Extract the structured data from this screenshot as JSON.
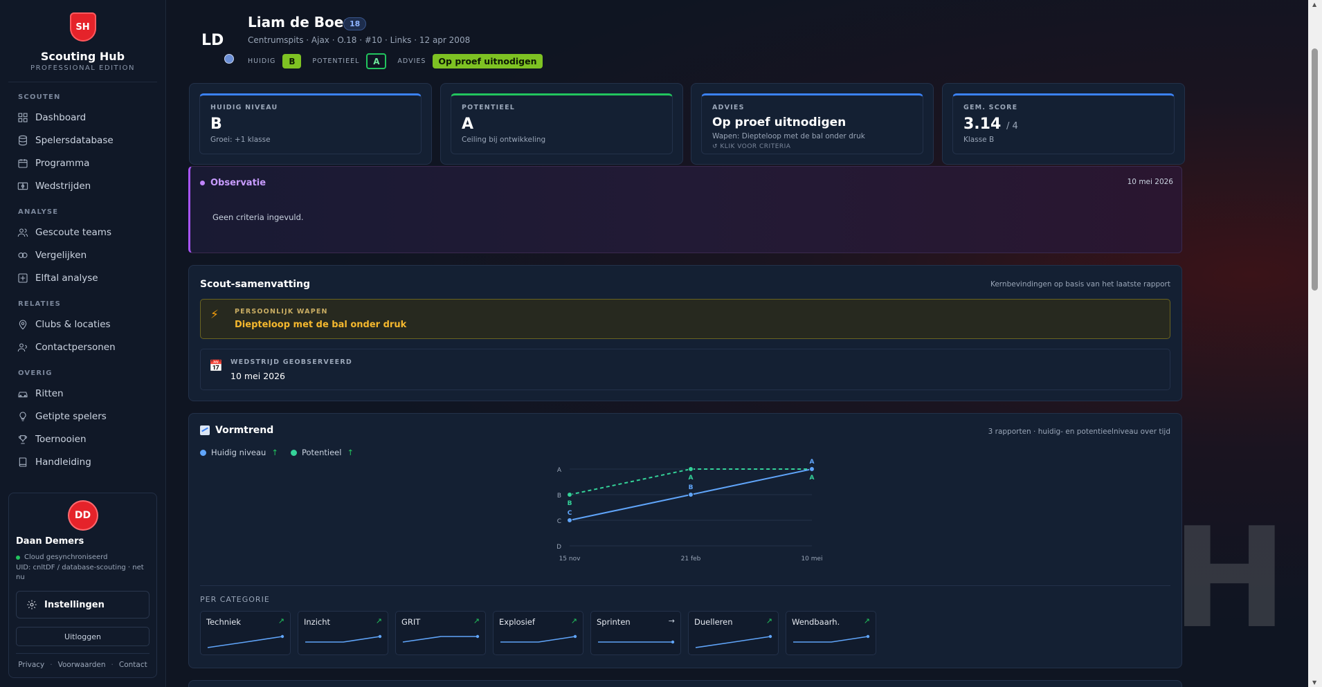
{
  "brand": {
    "logo": "SH",
    "name": "Scouting Hub",
    "edition": "PROFESSIONAL EDITION"
  },
  "nav": {
    "sections": [
      {
        "title": "SCOUTEN",
        "items": [
          {
            "label": "Dashboard",
            "icon": "dashboard-icon"
          },
          {
            "label": "Spelersdatabase",
            "icon": "database-icon"
          },
          {
            "label": "Programma",
            "icon": "calendar-icon"
          },
          {
            "label": "Wedstrijden",
            "icon": "field-icon"
          }
        ]
      },
      {
        "title": "ANALYSE",
        "items": [
          {
            "label": "Gescoute teams",
            "icon": "users-icon"
          },
          {
            "label": "Vergelijken",
            "icon": "compare-icon"
          },
          {
            "label": "Elftal analyse",
            "icon": "lineup-icon"
          }
        ]
      },
      {
        "title": "RELATIES",
        "items": [
          {
            "label": "Clubs & locaties",
            "icon": "map-pin-icon"
          },
          {
            "label": "Contactpersonen",
            "icon": "contacts-icon"
          }
        ]
      },
      {
        "title": "OVERIG",
        "items": [
          {
            "label": "Ritten",
            "icon": "car-icon"
          },
          {
            "label": "Getipte spelers",
            "icon": "lightbulb-icon"
          },
          {
            "label": "Toernooien",
            "icon": "trophy-icon"
          },
          {
            "label": "Handleiding",
            "icon": "book-icon"
          }
        ]
      }
    ]
  },
  "user": {
    "initials": "DD",
    "name": "Daan Demers",
    "sync_status": "Cloud gesynchroniseerd",
    "uid": "UID: cnltDF / database-scouting · net nu",
    "settings_label": "Instellingen",
    "logout_label": "Uitloggen",
    "links": [
      "Privacy",
      "Voorwaarden",
      "Contact"
    ]
  },
  "player": {
    "initials": "LD",
    "name": "Liam de Boer",
    "age": "18",
    "meta": "Centrumspits · Ajax · O.18 · #10 · Links · 12 apr 2008",
    "current_label": "HUIDIG",
    "current": "B",
    "potential_label": "POTENTIEEL",
    "potential": "A",
    "advice_label": "ADVIES",
    "advice": "Op proef uitnodigen"
  },
  "stats": [
    {
      "label": "HUIDIG NIVEAU",
      "value": "B",
      "sub": "Groei: +1 klasse"
    },
    {
      "label": "POTENTIEEL",
      "value": "A",
      "sub": "Ceiling bij ontwikkeling"
    },
    {
      "label": "ADVIES",
      "value": "Op proef uitnodigen",
      "sub": "Wapen: Diepteloop met de bal onder druk",
      "hint": "↺ KLIK VOOR CRITERIA"
    },
    {
      "label": "GEM. SCORE",
      "value": "3.14",
      "value_suffix": "/ 4",
      "sub": "Klasse B"
    }
  ],
  "observation": {
    "title": "Observatie",
    "date": "10 mei 2026",
    "text": "Geen criteria ingevuld."
  },
  "summary": {
    "title": "Scout-samenvatting",
    "note": "Kernbevindingen op basis van het laatste rapport",
    "weapon_label": "PERSOONLIJK WAPEN",
    "weapon": "Diepteloop met de bal onder druk",
    "match_label": "WEDSTRIJD GEOBSERVEERD",
    "match": "10 mei 2026"
  },
  "trend": {
    "title": "Vormtrend",
    "note": "3 rapporten · huidig- en potentieelniveau over tijd",
    "legend": [
      {
        "name": "Huidig niveau",
        "color": "#60a5fa",
        "arrow": "↑"
      },
      {
        "name": "Potentieel",
        "color": "#34d399",
        "arrow": "↑"
      }
    ],
    "category_title": "PER CATEGORIE",
    "categories": [
      {
        "name": "Techniek",
        "arrow": "↗",
        "values": [
          1,
          2,
          3
        ]
      },
      {
        "name": "Inzicht",
        "arrow": "↗",
        "values": [
          2,
          2,
          3
        ]
      },
      {
        "name": "GRIT",
        "arrow": "↗",
        "values": [
          2,
          3,
          3
        ]
      },
      {
        "name": "Explosief",
        "arrow": "↗",
        "values": [
          2,
          2,
          3
        ]
      },
      {
        "name": "Sprinten",
        "arrow": "→",
        "values": [
          2,
          2,
          2
        ]
      },
      {
        "name": "Duelleren",
        "arrow": "↗",
        "values": [
          1,
          2,
          3
        ]
      },
      {
        "name": "Wendbaarh.",
        "arrow": "↗",
        "values": [
          2,
          2,
          3
        ]
      }
    ]
  },
  "chart_data": {
    "type": "line",
    "x": [
      "15 nov",
      "21 feb",
      "10 mei"
    ],
    "y_ticks": [
      "D",
      "C",
      "B",
      "A"
    ],
    "series": [
      {
        "name": "Huidig niveau",
        "values": [
          "C",
          "B",
          "A"
        ],
        "color": "#60a5fa",
        "dashed": false
      },
      {
        "name": "Potentieel",
        "values": [
          "B",
          "A",
          "A"
        ],
        "color": "#34d399",
        "dashed": true
      }
    ],
    "legend": "top-left",
    "grid": true
  },
  "bg_watermark": "H"
}
